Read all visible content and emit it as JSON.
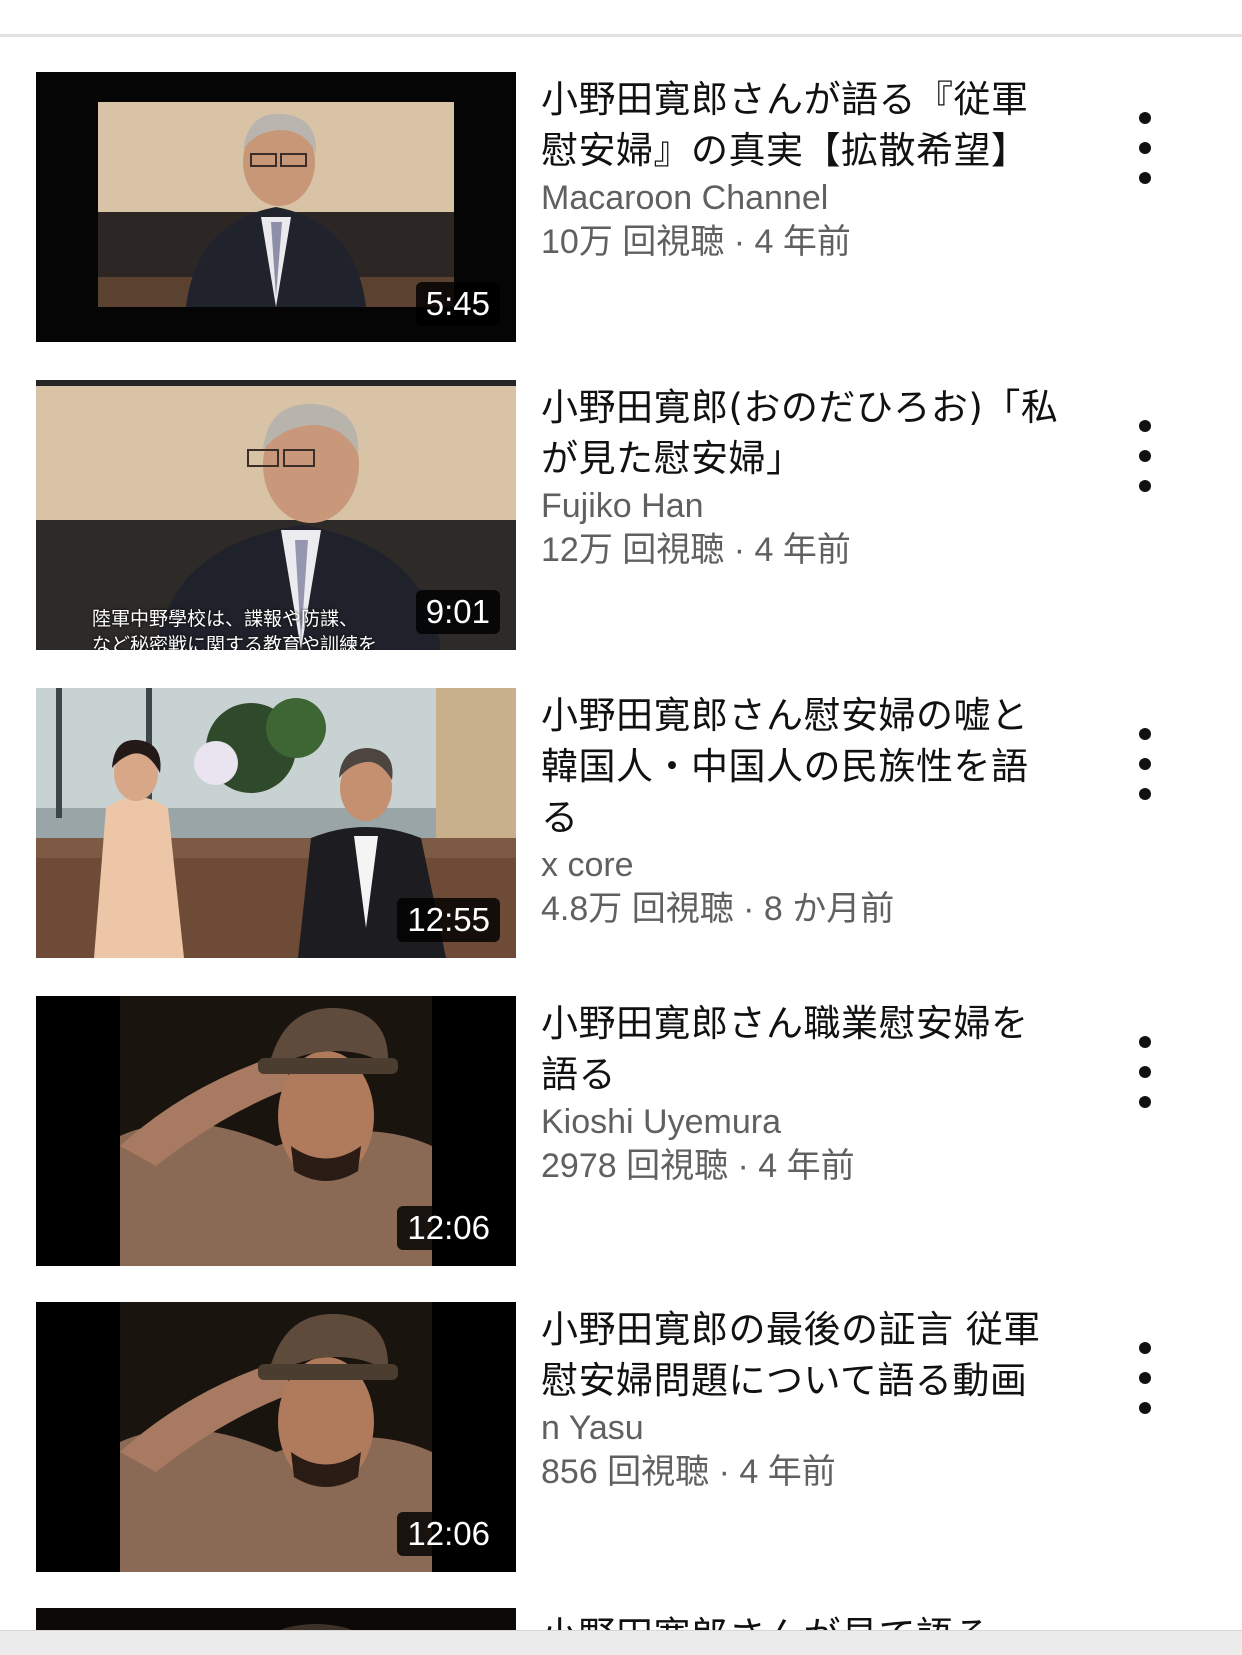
{
  "videos": [
    {
      "title": "小野田寛郎さんが語る『従軍慰安婦』の真実【拡散希望】",
      "channel": "Macaroon Channel",
      "meta": "10万 回視聴 · 4 年前",
      "duration": "5:45",
      "thumbnail": "elderly-man-interview-thumbnail"
    },
    {
      "title": "小野田寛郎(おのだひろお)「私が見た慰安婦」",
      "channel": "Fujiko Han",
      "meta": "12万 回視聴 · 4 年前",
      "duration": "9:01",
      "thumbnail": "elderly-man-smiling-thumbnail",
      "subtitle_caption": "陸軍中野學校は、諜報や防諜、",
      "subtitle_caption_line2": "など秘密戦に関する教育や訓練を"
    },
    {
      "title": "小野田寛郎さん慰安婦の嘘と韓国人・中国人の民族性を語る",
      "channel": "x core",
      "meta": "4.8万 回視聴 · 8 か月前",
      "duration": "12:55",
      "thumbnail": "tv-interview-two-people-thumbnail"
    },
    {
      "title": "小野田寛郎さん職業慰安婦を語る",
      "channel": "Kioshi Uyemura",
      "meta": "2978 回視聴 · 4 年前",
      "duration": "12:06",
      "thumbnail": "saluting-soldier-thumbnail"
    },
    {
      "title": "小野田寛郎の最後の証言 従軍慰安婦問題について語る動画",
      "channel": "n Yasu",
      "meta": "856 回視聴 · 4 年前",
      "duration": "12:06",
      "thumbnail": "saluting-soldier-thumbnail"
    },
    {
      "title": "小野田寛郎さんが見て語る",
      "channel": "",
      "meta": "",
      "duration": "",
      "thumbnail": "partial-thumbnail"
    }
  ],
  "icons": {
    "more": "more-vertical-icon"
  }
}
